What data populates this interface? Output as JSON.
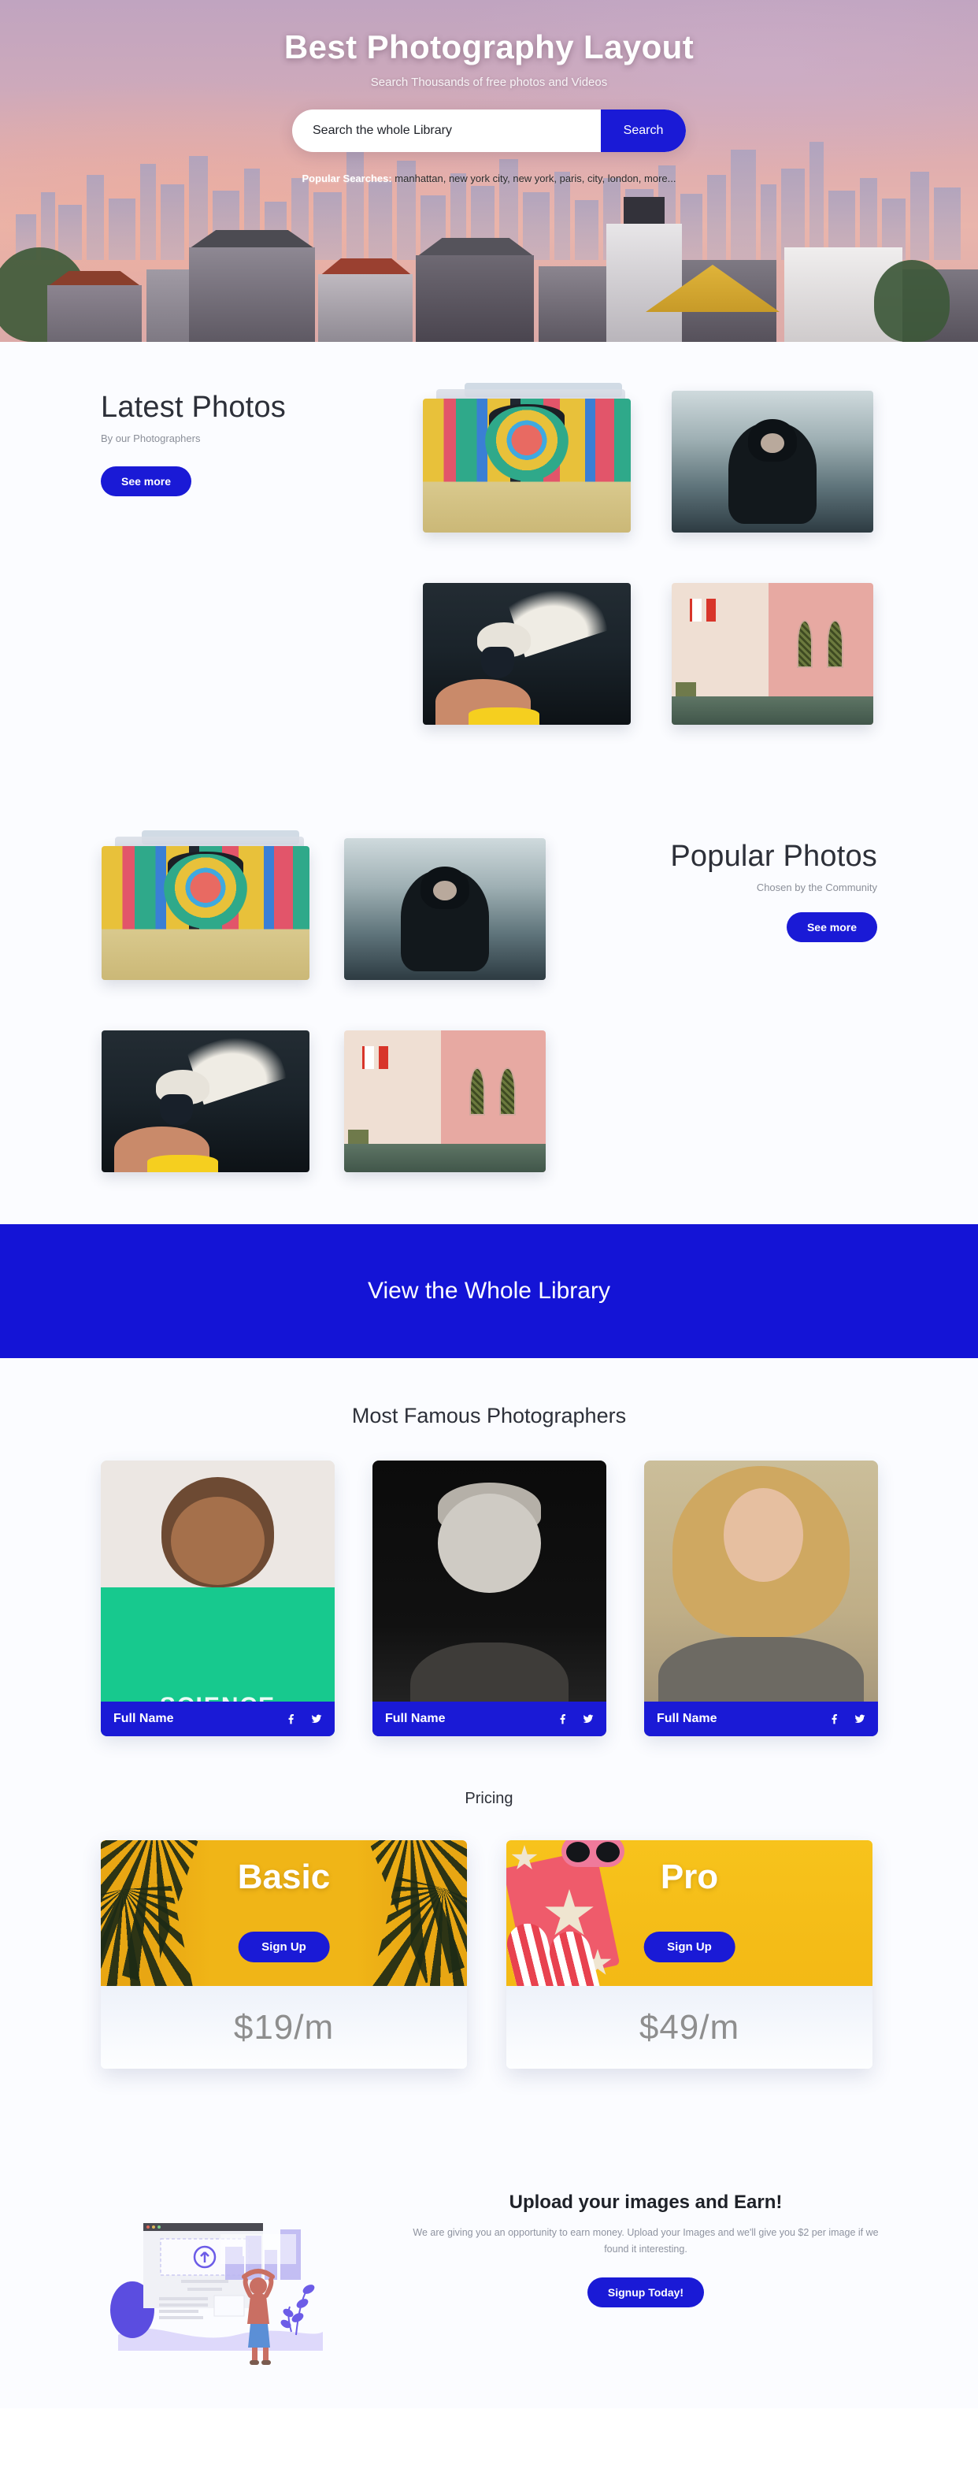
{
  "hero": {
    "title": "Best Photography Layout",
    "subtitle": "Search Thousands of free photos and Videos",
    "search_placeholder": "Search the whole Library",
    "search_value": "",
    "search_button": "Search",
    "popular_label": "Popular Searches:",
    "popular_terms": "manhattan, new york city, new york, paris, city, london, more..."
  },
  "latest": {
    "title": "Latest Photos",
    "subtitle": "By our Photographers",
    "button": "See more",
    "photos": [
      {
        "alt": "colorful street mural of an indigenous face"
      },
      {
        "alt": "person in black hoodie sitting against concrete wall"
      },
      {
        "alt": "bird head with steam, held in a hand"
      },
      {
        "alt": "pink and beige wall with two arched windows"
      }
    ]
  },
  "popular": {
    "title": "Popular Photos",
    "subtitle": "Chosen by the Community",
    "button": "See more",
    "photos": [
      {
        "alt": "colorful street mural of an indigenous face"
      },
      {
        "alt": "person in black hoodie sitting against concrete wall"
      },
      {
        "alt": "bird head with steam, held in a hand"
      },
      {
        "alt": "pink and beige wall with two arched windows"
      }
    ]
  },
  "banner": {
    "text": "View the Whole Library"
  },
  "photographers": {
    "title": "Most Famous Photographers",
    "cards": [
      {
        "name": "Full Name",
        "facebook": "f",
        "twitter": "twitter-bird",
        "alt": "smiling man in green science t-shirt"
      },
      {
        "name": "Full Name",
        "facebook": "f",
        "twitter": "twitter-bird",
        "alt": "black and white portrait of smiling young man"
      },
      {
        "name": "Full Name",
        "facebook": "f",
        "twitter": "twitter-bird",
        "alt": "smiling blonde woman in grey top"
      }
    ]
  },
  "pricing": {
    "title": "Pricing",
    "plans": [
      {
        "name": "Basic",
        "button": "Sign Up",
        "amount": "$19/m",
        "alt": "yellow background with palm leaves"
      },
      {
        "name": "Pro",
        "button": "Sign Up",
        "amount": "$49/m",
        "alt": "yellow background with starfish, sunglasses and flip flops"
      }
    ]
  },
  "footer": {
    "heading": "Upload your images and Earn!",
    "paragraph": "We are giving you an opportunity to earn money. Upload your Images and we'll give you $2 per image if we found it interesting.",
    "button": "Signup Today!",
    "illustration_alt": "person lifting images into a browser upload window"
  },
  "colors": {
    "brand_blue": "#1a1ad6",
    "banner_blue": "#1414d6",
    "page_bg": "#fbfcff",
    "heading": "#2d3039",
    "muted": "#8b8f99",
    "price_text": "#8e8e8e",
    "pricing_yellow": "#f0b517"
  }
}
